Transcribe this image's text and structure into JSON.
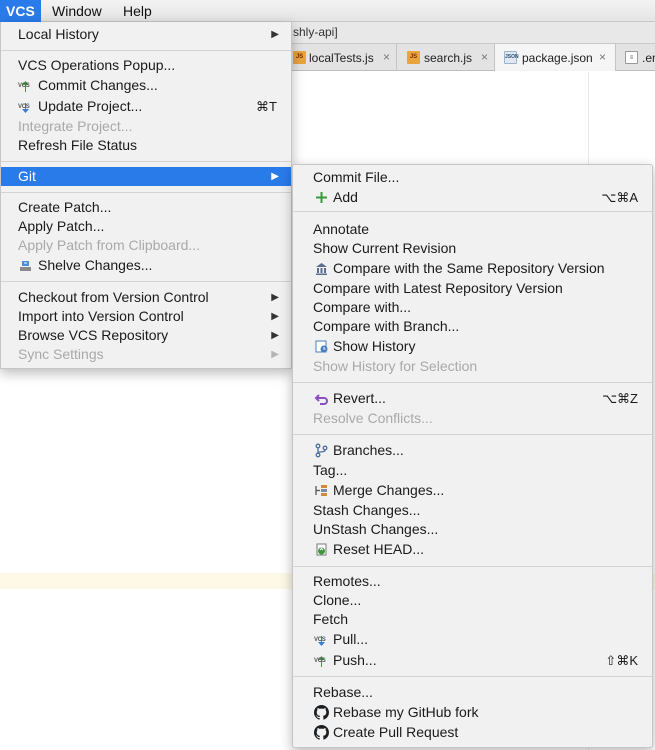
{
  "menubar": {
    "vcs": "VCS",
    "window": "Window",
    "help": "Help"
  },
  "ide": {
    "title_fragment": "shly-api]",
    "tabs": [
      {
        "icon": "JS",
        "label": "localTests.js",
        "close": "×"
      },
      {
        "icon": "JS",
        "label": "search.js",
        "close": "×"
      },
      {
        "icon": "JSON",
        "label": "package.json",
        "close": "×"
      },
      {
        "icon": "≡",
        "label": ".en"
      }
    ]
  },
  "vcs_menu": {
    "local_history": "Local History",
    "operations_popup": "VCS Operations Popup...",
    "commit_changes": "Commit Changes...",
    "update_project": "Update Project...",
    "update_project_shortcut": "⌘T",
    "integrate_project": "Integrate Project...",
    "refresh_status": "Refresh File Status",
    "git": "Git",
    "create_patch": "Create Patch...",
    "apply_patch": "Apply Patch...",
    "apply_patch_clipboard": "Apply Patch from Clipboard...",
    "shelve_changes": "Shelve Changes...",
    "checkout": "Checkout from Version Control",
    "import": "Import into Version Control",
    "browse": "Browse VCS Repository",
    "sync": "Sync Settings",
    "vcs_badge": "VCS"
  },
  "git_menu": {
    "commit_file": "Commit File...",
    "add": "Add",
    "add_shortcut": "⌥⌘A",
    "annotate": "Annotate",
    "show_current_revision": "Show Current Revision",
    "compare_same_repo": "Compare with the Same Repository Version",
    "compare_latest_repo": "Compare with Latest Repository Version",
    "compare_with": "Compare with...",
    "compare_branch": "Compare with Branch...",
    "show_history": "Show History",
    "show_history_selection": "Show History for Selection",
    "revert": "Revert...",
    "revert_shortcut": "⌥⌘Z",
    "resolve_conflicts": "Resolve Conflicts...",
    "branches": "Branches...",
    "tag": "Tag...",
    "merge_changes": "Merge Changes...",
    "stash_changes": "Stash Changes...",
    "unstash_changes": "UnStash Changes...",
    "reset_head": "Reset HEAD...",
    "remotes": "Remotes...",
    "clone": "Clone...",
    "fetch": "Fetch",
    "pull": "Pull...",
    "push": "Push...",
    "push_shortcut": "⇧⌘K",
    "rebase": "Rebase...",
    "rebase_github": "Rebase my GitHub fork",
    "create_pull_request": "Create Pull Request",
    "vcs_badge": "VCS"
  },
  "colors": {
    "highlight": "#2a7bea",
    "menu_bg": "#f1f1f1",
    "disabled": "#a9a9a9"
  }
}
